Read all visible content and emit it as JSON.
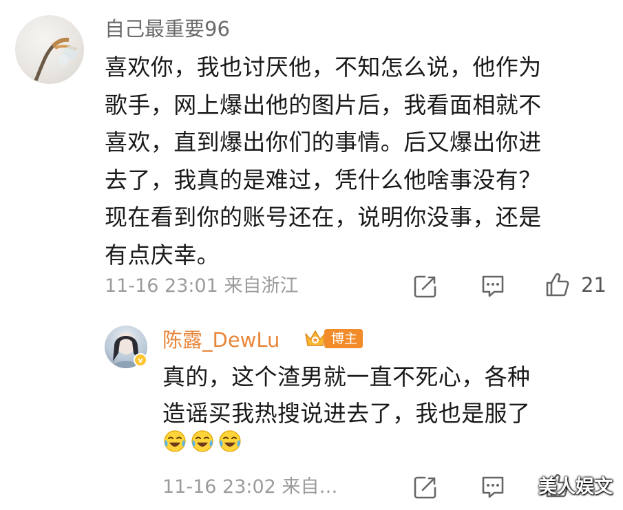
{
  "comment": {
    "username": "自己最重要96",
    "lines": [
      "喜欢你，我也讨厌他，不知怎么说，他作为",
      "歌手，网上爆出他的图片后，我看面相就不",
      "喜欢，直到爆出你们的事情。后又爆出你进",
      "去了，我真的是难过，凭什么他啥事没有？",
      "现在看到你的账号还在，说明你没事，还是",
      "有点庆幸。"
    ],
    "time": "11-16 23:01",
    "location": "来自浙江",
    "like_count": "21",
    "icons": [
      "avatar",
      "share-icon",
      "comment-icon",
      "like-icon"
    ]
  },
  "reply": {
    "username": "陈露_DewLu",
    "badge_label": "博主",
    "verified_mark": "v",
    "lines": [
      "真的，这个渣男就一直不死心，各种",
      "造谣买我热搜说进去了，我也是服了"
    ],
    "emojis": [
      "laugh-cry-emoji",
      "laugh-cry-emoji",
      "laugh-cry-emoji"
    ],
    "time": "11-16 23:02",
    "location": "来自…",
    "icons": [
      "avatar",
      "crown-icon",
      "share-icon",
      "comment-icon",
      "like-icon"
    ]
  },
  "watermark": "美人娱文",
  "colors": {
    "reply_name": "#e8863a",
    "badge": "#f28b2a",
    "meta_text": "#9b9b9b"
  }
}
